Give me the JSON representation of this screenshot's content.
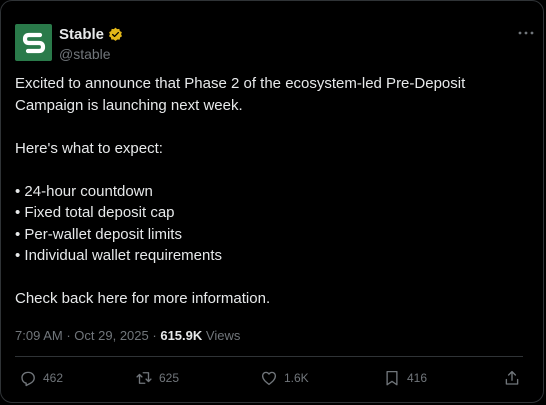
{
  "author": {
    "display_name": "Stable",
    "handle": "@stable"
  },
  "tweet": {
    "line1": "Excited to announce that Phase 2 of the ecosystem-led Pre-Deposit",
    "line2": "Campaign is launching next week.",
    "line3": "Here's what to expect:",
    "bullets": [
      "• 24-hour countdown",
      "• Fixed total deposit cap",
      "• Per-wallet deposit limits",
      "• Individual wallet requirements"
    ],
    "closing": "Check back here for more information."
  },
  "meta": {
    "time": "7:09 AM",
    "separator": "·",
    "date": "Oct 29, 2025",
    "views_count": "615.9K",
    "views_label": "Views"
  },
  "actions": {
    "replies": "462",
    "reposts": "625",
    "likes": "1.6K",
    "bookmarks": "416"
  },
  "colors": {
    "brand_green": "#2a7a4a",
    "verified_gold": "#e2b719",
    "muted": "#71767b"
  }
}
